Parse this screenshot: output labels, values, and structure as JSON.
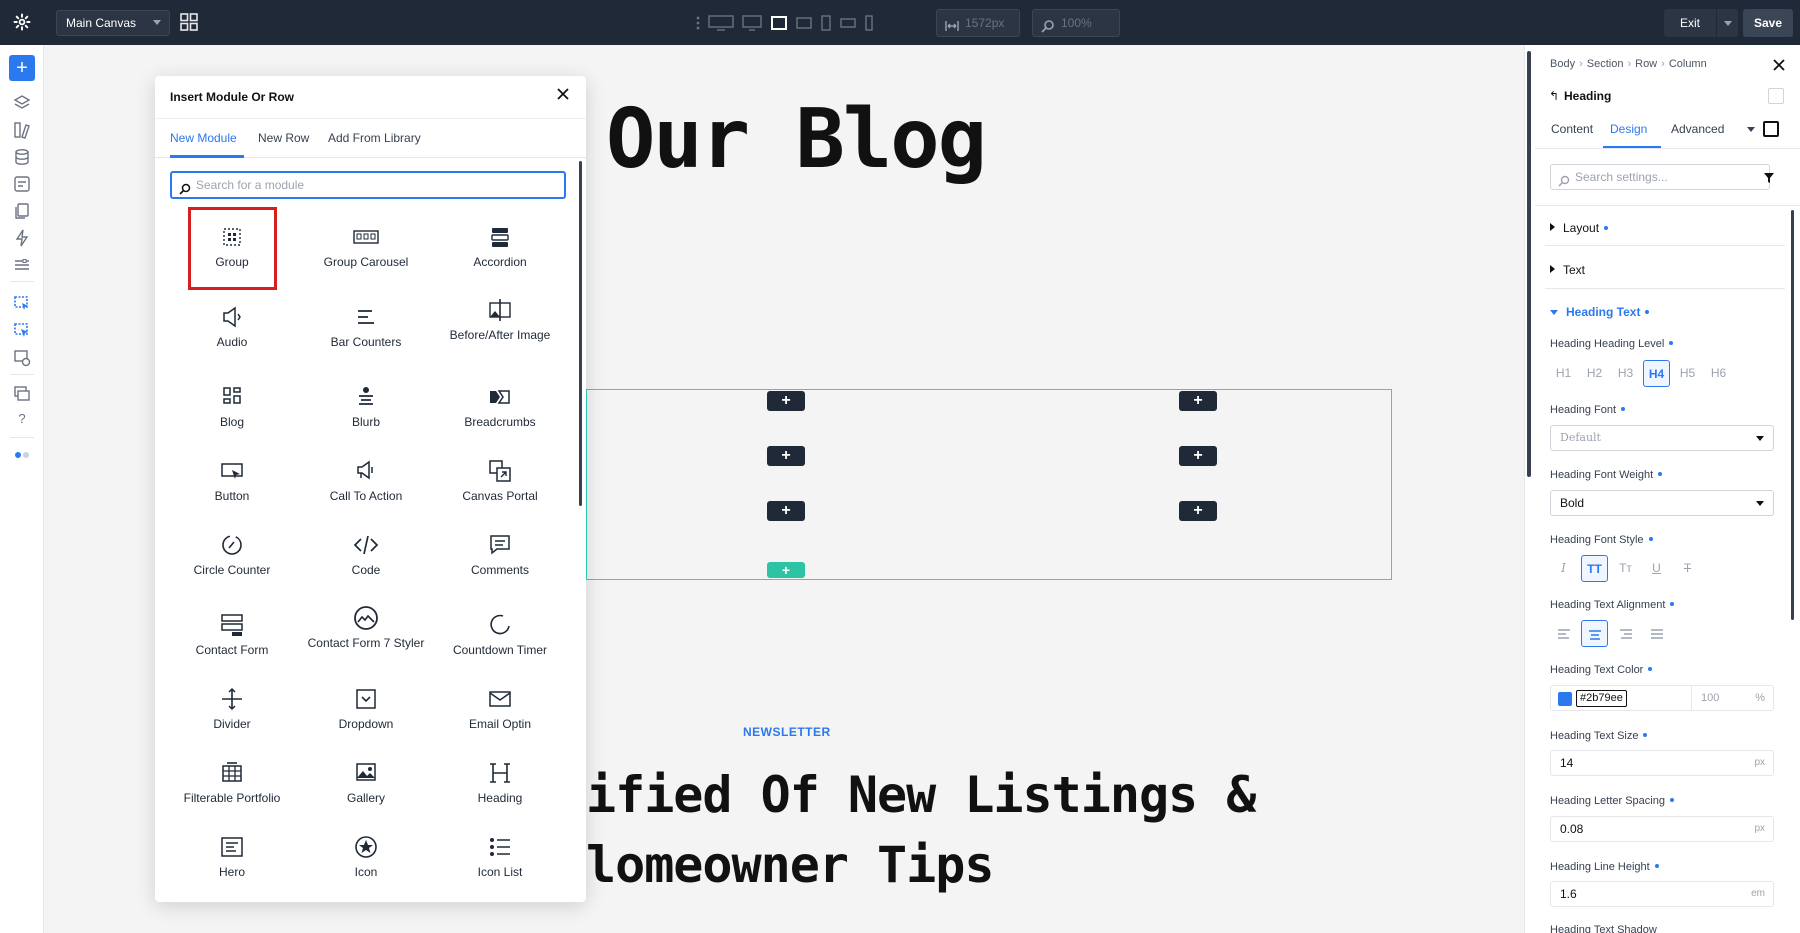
{
  "topbar": {
    "canvas_name": "Main Canvas",
    "width_readout": "1572px",
    "zoom_readout": "100%",
    "exit_label": "Exit",
    "save_label": "Save"
  },
  "canvas": {
    "blog_title": "Our Blog",
    "newsletter_label": "NEWSLETTER",
    "headline_line1": "ified Of New Listings &",
    "headline_line2": "lomeowner Tips",
    "outline_color": "#2dd4bf"
  },
  "modal": {
    "title": "Insert Module Or Row",
    "tabs": [
      "New Module",
      "New Row",
      "Add From Library"
    ],
    "search_placeholder": "Search for a module",
    "modules": [
      {
        "label": "Group",
        "icon": "group-icon"
      },
      {
        "label": "Group Carousel",
        "icon": "group-carousel-icon"
      },
      {
        "label": "Accordion",
        "icon": "accordion-icon"
      },
      {
        "label": "Audio",
        "icon": "audio-icon"
      },
      {
        "label": "Bar Counters",
        "icon": "bar-counters-icon"
      },
      {
        "label": "Before/After Image",
        "icon": "before-after-image-icon"
      },
      {
        "label": "Blog",
        "icon": "blog-icon"
      },
      {
        "label": "Blurb",
        "icon": "blurb-icon"
      },
      {
        "label": "Breadcrumbs",
        "icon": "breadcrumbs-icon"
      },
      {
        "label": "Button",
        "icon": "button-icon"
      },
      {
        "label": "Call To Action",
        "icon": "call-to-action-icon"
      },
      {
        "label": "Canvas Portal",
        "icon": "canvas-portal-icon"
      },
      {
        "label": "Circle Counter",
        "icon": "circle-counter-icon"
      },
      {
        "label": "Code",
        "icon": "code-icon"
      },
      {
        "label": "Comments",
        "icon": "comments-icon"
      },
      {
        "label": "Contact Form",
        "icon": "contact-form-icon"
      },
      {
        "label": "Contact Form 7 Styler",
        "icon": "contact-form-7-styler-icon"
      },
      {
        "label": "Countdown Timer",
        "icon": "countdown-timer-icon"
      },
      {
        "label": "Divider",
        "icon": "divider-icon"
      },
      {
        "label": "Dropdown",
        "icon": "dropdown-icon"
      },
      {
        "label": "Email Optin",
        "icon": "email-optin-icon"
      },
      {
        "label": "Filterable Portfolio",
        "icon": "filterable-portfolio-icon"
      },
      {
        "label": "Gallery",
        "icon": "gallery-icon"
      },
      {
        "label": "Heading",
        "icon": "heading-icon"
      },
      {
        "label": "Hero",
        "icon": "hero-icon"
      },
      {
        "label": "Icon",
        "icon": "icon-icon"
      },
      {
        "label": "Icon List",
        "icon": "icon-list-icon"
      }
    ]
  },
  "panel": {
    "breadcrumbs": [
      "Body",
      "Section",
      "Row",
      "Column"
    ],
    "element_name": "Heading",
    "tabs": [
      "Content",
      "Design",
      "Advanced"
    ],
    "search_placeholder": "Search settings...",
    "groups": {
      "layout": "Layout",
      "text": "Text",
      "heading_text": "Heading Text"
    },
    "labels": {
      "heading_level": "Heading Heading Level",
      "heading_font": "Heading Font",
      "font_weight": "Heading Font Weight",
      "font_style": "Heading Font Style",
      "text_alignment": "Heading Text Alignment",
      "text_color": "Heading Text Color",
      "text_size": "Heading Text Size",
      "letter_spacing": "Heading Letter Spacing",
      "line_height": "Heading Line Height",
      "text_shadow": "Heading Text Shadow"
    },
    "heading_levels": [
      "H1",
      "H2",
      "H3",
      "H4",
      "H5",
      "H6"
    ],
    "selected_level": "H4",
    "font_value": "Default",
    "font_weight_value": "Bold",
    "text_color": "#2b79ee",
    "text_color_opacity": "100",
    "opacity_unit": "%",
    "text_size": "14",
    "text_size_unit": "px",
    "letter_spacing": "0.08",
    "letter_spacing_unit": "px",
    "line_height": "1.6",
    "line_height_unit": "em"
  }
}
